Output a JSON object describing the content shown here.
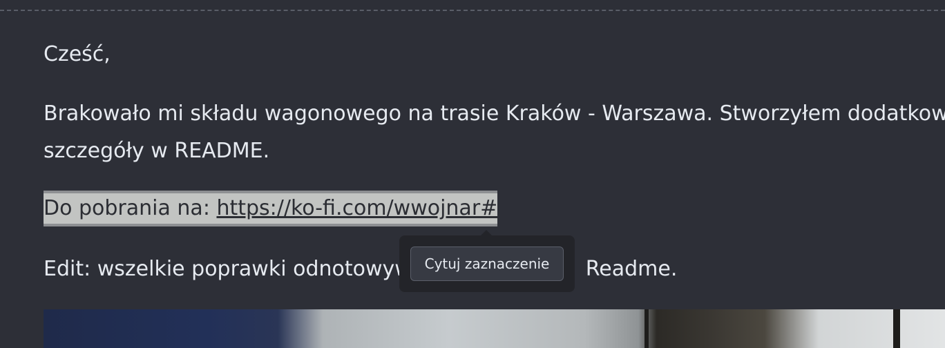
{
  "post": {
    "greeting": "Cześć,",
    "body_line1": "Brakowało mi składu wagonowego na trasie Kraków - Warszawa. Stworzyłem dodatkowy s",
    "body_line2": "szczegóły w README.",
    "download_prefix": "Do pobrania na: ",
    "download_link": "https://ko-fi.com/wwojnar#",
    "edit_before": "Edit: wszelkie poprawki odnotowyw",
    "edit_after": "Readme."
  },
  "quote_popup": {
    "button_label": "Cytuj zaznaczenie"
  },
  "colors": {
    "background": "#2d2f37",
    "text": "#e6eaf0",
    "selection": "#c2c4c2"
  }
}
